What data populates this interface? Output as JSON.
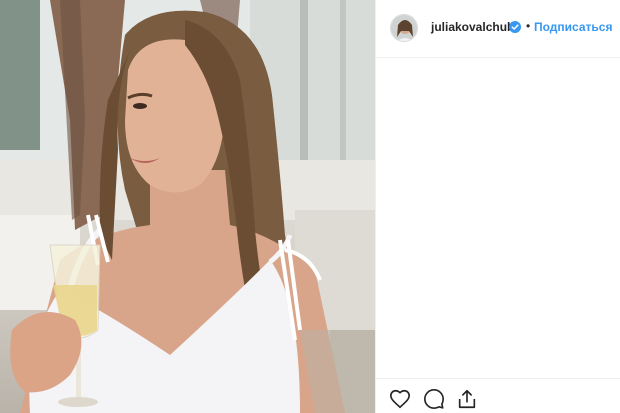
{
  "post": {
    "username": "juliakovalchuk",
    "separator": "•",
    "follow_label": "Подписаться",
    "accent_color": "#3897f0",
    "verified_icon": "verified-badge-icon"
  },
  "actions": [
    {
      "icon": "heart-icon",
      "label": "like"
    },
    {
      "icon": "comment-icon",
      "label": "comment"
    },
    {
      "icon": "share-icon",
      "label": "share"
    }
  ]
}
